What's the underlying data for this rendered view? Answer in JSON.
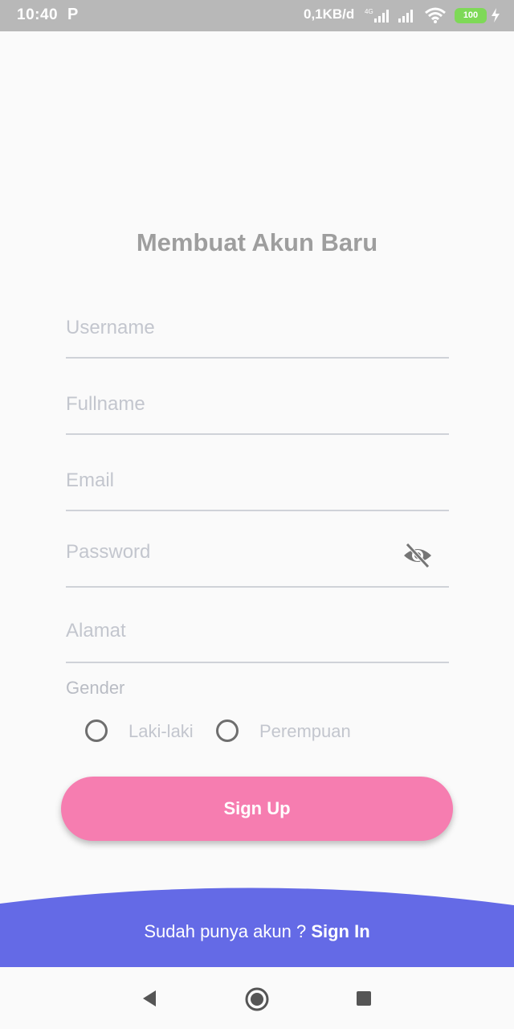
{
  "status_bar": {
    "time": "10:40",
    "p_icon": "P",
    "net_speed": "0,1KB/d",
    "battery": "100",
    "network_badge": "4G",
    "icons": [
      "parking-icon",
      "signal-4g-icon",
      "signal-icon",
      "wifi-icon",
      "battery-icon",
      "charging-icon"
    ]
  },
  "form": {
    "title": "Membuat Akun Baru",
    "username_placeholder": "Username",
    "fullname_placeholder": "Fullname",
    "email_placeholder": "Email",
    "password_placeholder": "Password",
    "address_placeholder": "Alamat",
    "gender_label": "Gender",
    "gender_options": [
      "Laki-laki",
      "Perempuan"
    ],
    "submit_label": "Sign Up"
  },
  "footer": {
    "prompt": "Sudah punya akun ?",
    "signin_label": "Sign In"
  },
  "colors": {
    "accent_pink": "#f67db0",
    "footer_blue": "#646ae6",
    "title_gray": "#9e9e9e",
    "placeholder_gray": "#c3c6ce"
  }
}
